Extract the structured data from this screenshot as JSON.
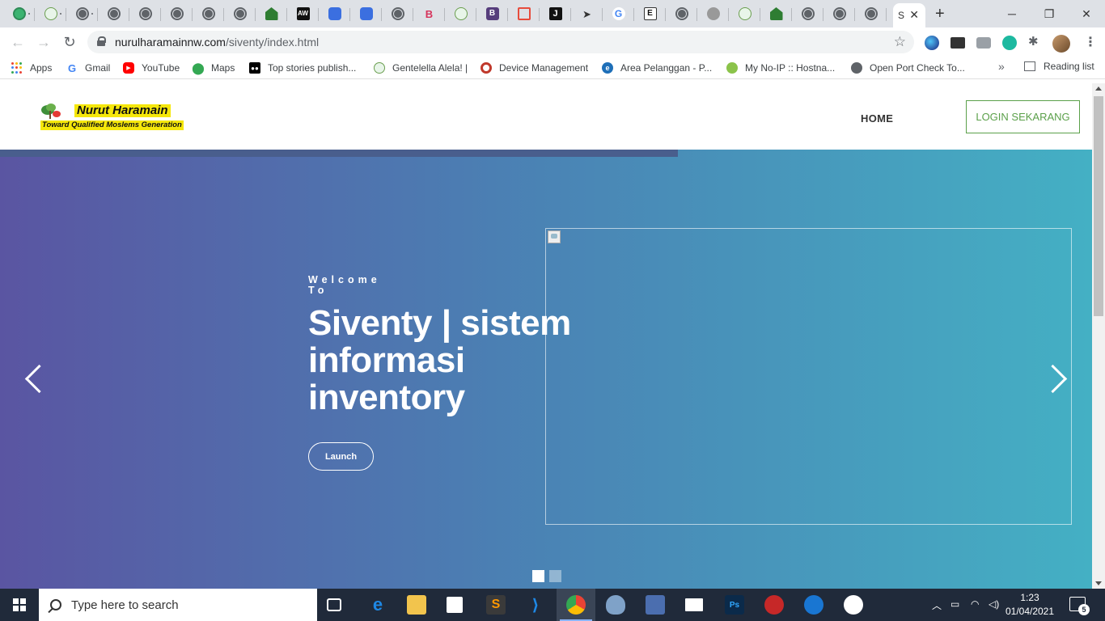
{
  "browser": {
    "tabs": [
      {
        "icon": "nh-green-icon"
      },
      {
        "icon": "nh-green-icon"
      },
      {
        "icon": "globe-icon"
      },
      {
        "icon": "globe-icon"
      },
      {
        "icon": "globe-icon"
      },
      {
        "icon": "globe-icon"
      },
      {
        "icon": "globe-icon"
      },
      {
        "icon": "globe-icon"
      },
      {
        "icon": "house-icon"
      },
      {
        "icon": "aw-icon",
        "text": "AW"
      },
      {
        "icon": "refresh-blue-icon"
      },
      {
        "icon": "refresh-blue-icon"
      },
      {
        "icon": "globe-icon"
      },
      {
        "icon": "b-red-icon",
        "text": "B"
      },
      {
        "icon": "nh-green-icon"
      },
      {
        "icon": "bootstrap-icon",
        "text": "B"
      },
      {
        "icon": "laravel-icon"
      },
      {
        "icon": "j-icon",
        "text": "J"
      },
      {
        "icon": "send-icon"
      },
      {
        "icon": "google-icon",
        "text": "G"
      },
      {
        "icon": "e-icon",
        "text": "E"
      },
      {
        "icon": "globe-icon"
      },
      {
        "icon": "apple-icon"
      },
      {
        "icon": "nh-green-icon"
      },
      {
        "icon": "house-icon"
      },
      {
        "icon": "globe-icon"
      },
      {
        "icon": "globe-icon"
      },
      {
        "icon": "globe-icon"
      }
    ],
    "active_tab_title": "S",
    "address": {
      "host": "nurulharamainnw.com",
      "path": "/siventy/index.html"
    },
    "bookmarks": [
      {
        "label": "Apps",
        "icon": "apps-grid-icon"
      },
      {
        "label": "Gmail",
        "icon": "google-icon"
      },
      {
        "label": "YouTube",
        "icon": "youtube-icon"
      },
      {
        "label": "Maps",
        "icon": "maps-pin-icon"
      },
      {
        "label": "Top stories publish...",
        "icon": "medium-icon"
      },
      {
        "label": "Gentelella Alela! |",
        "icon": "gentelella-icon"
      },
      {
        "label": "Device Management",
        "icon": "device-icon"
      },
      {
        "label": "Area Pelanggan - P...",
        "icon": "e-blue-icon"
      },
      {
        "label": "My No-IP :: Hostna...",
        "icon": "noip-icon"
      },
      {
        "label": "Open Port Check To...",
        "icon": "globe-icon"
      }
    ],
    "reading_list": "Reading list"
  },
  "site": {
    "logo": {
      "line1": "Nurut Haramain",
      "line2": "Toward Qualified Moslems Generation"
    },
    "nav_home": "HOME",
    "login_label": "LOGIN SEKARANG",
    "hero": {
      "welcome": "Welcome To",
      "headline": "Siventy | sistem informasi inventory",
      "launch_label": "Launch"
    }
  },
  "taskbar": {
    "search_placeholder": "Type here to search",
    "time": "1:23",
    "date": "01/04/2021",
    "notifications": "5"
  },
  "colors": {
    "hero_start": "#5a55a2",
    "hero_end": "#44b0c4",
    "login_accent": "#5ba04a",
    "taskbar_bg": "#202a3a"
  }
}
